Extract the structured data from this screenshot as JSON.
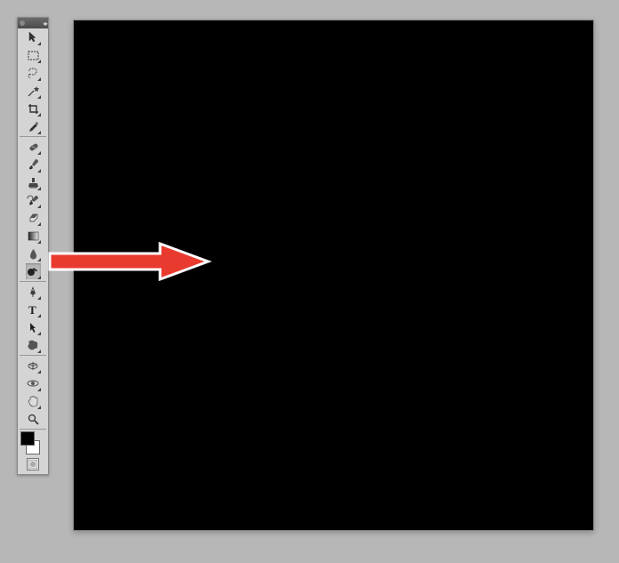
{
  "app": "Photoshop",
  "canvas": {
    "fill": "#000000",
    "border": "#888888"
  },
  "swatches": {
    "foreground": "#000000",
    "background": "#ffffff"
  },
  "annotation": {
    "arrow_color": "#e83a2e",
    "arrow_stroke": "#ffffff",
    "points_to": "dodge-burn-sponge-tool"
  },
  "tools": {
    "move": "Move Tool",
    "marquee": "Rectangular Marquee",
    "lasso": "Lasso Tool",
    "wand": "Quick Selection",
    "crop": "Crop Tool",
    "eyedropper": "Eyedropper",
    "heal": "Spot Healing Brush",
    "brush": "Brush Tool",
    "stamp": "Clone Stamp",
    "history": "History Brush",
    "eraser": "Eraser",
    "gradient": "Gradient / Paint Bucket",
    "blur": "Blur Tool",
    "dodge": "Dodge Tool",
    "pen": "Pen Tool",
    "type": "Horizontal Type",
    "path": "Path Selection",
    "shape": "Custom Shape",
    "3d": "3D Rotate",
    "3dcam": "3D Orbit Camera",
    "hand": "Hand Tool",
    "zoom": "Zoom Tool"
  }
}
